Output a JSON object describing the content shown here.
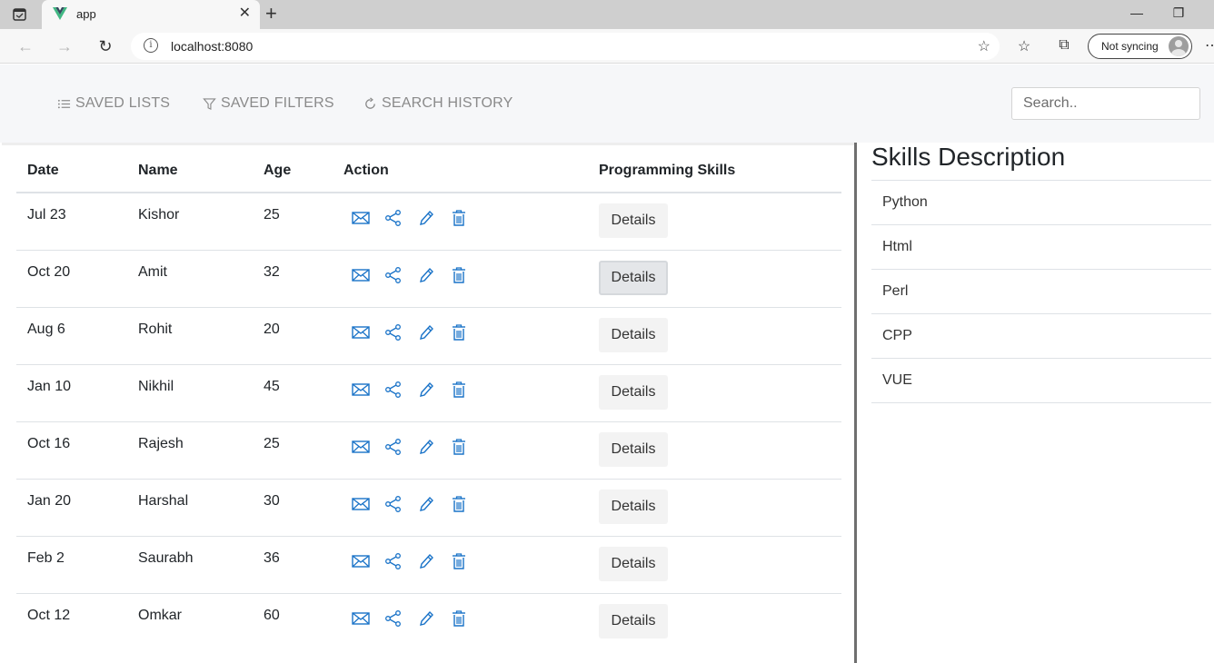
{
  "browser": {
    "tab_title": "app",
    "url": "localhost:8080",
    "sync_label": "Not syncing"
  },
  "nav": {
    "saved_lists": "SAVED LISTS",
    "saved_filters": "SAVED FILTERS",
    "search_history": "SEARCH HISTORY",
    "search_placeholder": "Search.."
  },
  "table": {
    "headers": {
      "date": "Date",
      "name": "Name",
      "age": "Age",
      "action": "Action",
      "skills": "Programming Skills"
    },
    "details_label": "Details",
    "rows": [
      {
        "date": "Jul 23",
        "name": "Kishor",
        "age": "25"
      },
      {
        "date": "Oct 20",
        "name": "Amit",
        "age": "32"
      },
      {
        "date": "Aug 6",
        "name": "Rohit",
        "age": "20"
      },
      {
        "date": "Jan 10",
        "name": "Nikhil",
        "age": "45"
      },
      {
        "date": "Oct 16",
        "name": "Rajesh",
        "age": "25"
      },
      {
        "date": "Jan 20",
        "name": "Harshal",
        "age": "30"
      },
      {
        "date": "Feb 2",
        "name": "Saurabh",
        "age": "36"
      },
      {
        "date": "Oct 12",
        "name": "Omkar",
        "age": "60"
      }
    ]
  },
  "skills": {
    "title": "Skills Description",
    "items": [
      "Python",
      "Html",
      "Perl",
      "CPP",
      "VUE"
    ]
  },
  "colors": {
    "icon_blue": "#1a73c8",
    "nav_gray": "#8a8a8a"
  }
}
